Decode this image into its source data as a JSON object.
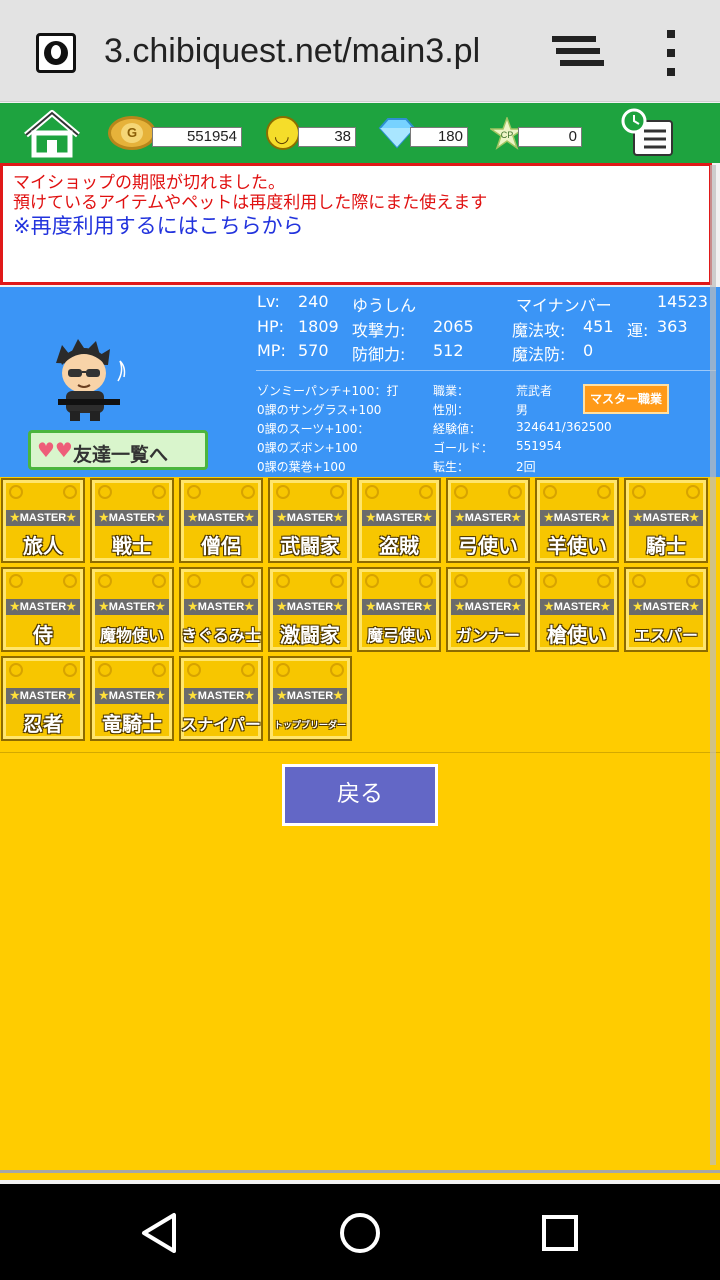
{
  "browser": {
    "url": "3.chibiquest.net/main3.pl"
  },
  "top_bar": {
    "gold": "551954",
    "smile": "38",
    "diamond": "180",
    "cp": "0",
    "coin_letter": "G",
    "cp_letter": "CP",
    "colors": {
      "accent_green": "#1ea33f"
    }
  },
  "notice": {
    "line1": "マイショップの期限が切れました。",
    "line2": "預けているアイテムやペットは再度利用した際にまた使えます",
    "link": "※再度利用するにはこちらから"
  },
  "profile": {
    "lv_label": "Lv:",
    "lv": "240",
    "name": "ゆうしん",
    "mynumber_label": "マイナンバー",
    "mynumber": "14523",
    "hp_label": "HP:",
    "hp": "1809",
    "atk_label": "攻撃力:",
    "atk": "2065",
    "matk_label": "魔法攻:",
    "matk": "451",
    "luck_label": "運:",
    "luck": "363",
    "mp_label": "MP:",
    "mp": "570",
    "def_label": "防御力:",
    "def": "512",
    "mdef_label": "魔法防:",
    "mdef": "0",
    "equipment": [
      "ゾンミーパンチ+100：打",
      "0課のサングラス+100",
      "0課のスーツ+100：",
      "0課のズボン+100",
      "0課の葉巻+100"
    ],
    "job_label": "職業：",
    "job": "荒武者",
    "gender_label": "性別：",
    "gender": "男",
    "exp_label": "経験値：",
    "exp": "324641/362500",
    "gold_label": "ゴールド：",
    "gold": "551954",
    "rebirth_label": "転生：",
    "rebirth": "2回",
    "master_job_button": "マスター職業",
    "friends_button": "友達一覧へ"
  },
  "jobs": {
    "master_label": "MASTER",
    "items": [
      "旅人",
      "戦士",
      "僧侶",
      "武闘家",
      "盗賊",
      "弓使い",
      "羊使い",
      "騎士",
      "侍",
      "魔物使い",
      "きぐるみ士",
      "激闘家",
      "魔弓使い",
      "ガンナー",
      "槍使い",
      "エスパー",
      "忍者",
      "竜騎士",
      "スナイパー",
      "トップブリーダー"
    ],
    "back_button": "戻る"
  }
}
